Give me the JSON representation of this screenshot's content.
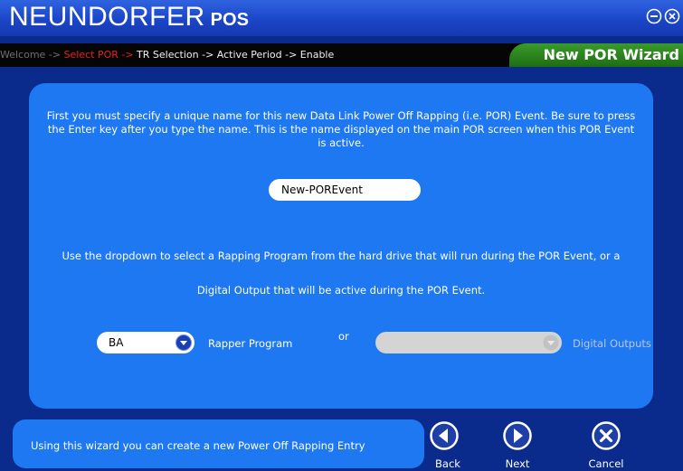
{
  "app": {
    "title": "NEUNDORFER",
    "subtitle": "POS"
  },
  "steps": {
    "done": "Welcome -> ",
    "current": "Select POR -> ",
    "rest": "TR Selection -> Active Period -> Enable"
  },
  "wizard": {
    "title": "New POR Wizard"
  },
  "main": {
    "instructions": "First you must specify a unique name for this new Data Link Power Off Rapping (i.e. POR) Event. Be sure to press the Enter key after you type the name. This is the name displayed on the main POR screen when this POR Event is active.",
    "name_value": "New-POREvent",
    "dropdown_text_1": "Use the dropdown to select a Rapping Program from the hard drive that will run during the POR Event, or a",
    "dropdown_text_2": "Digital Output that will be active during the POR Event.",
    "rapper_program": {
      "value": "BA",
      "label": "Rapper Program"
    },
    "or_label": "or",
    "digital_outputs": {
      "value": "",
      "label": "Digital Outputs"
    }
  },
  "footer": {
    "info": "Using this wizard you can create a new Power Off Rapping Entry",
    "back": "Back",
    "next": "Next",
    "cancel": "Cancel"
  },
  "colors": {
    "background": "#0a2a8c",
    "panel": "#1e78f2",
    "current_step": "#e32020",
    "wizard_tab": "#2e8a20"
  },
  "icons": {
    "minimize": "minus-circle-icon",
    "close": "x-circle-icon",
    "dropdown": "chevron-down-circle-icon",
    "back": "back-arrow-circle-icon",
    "next": "next-arrow-circle-icon",
    "cancel": "x-circle-icon"
  }
}
